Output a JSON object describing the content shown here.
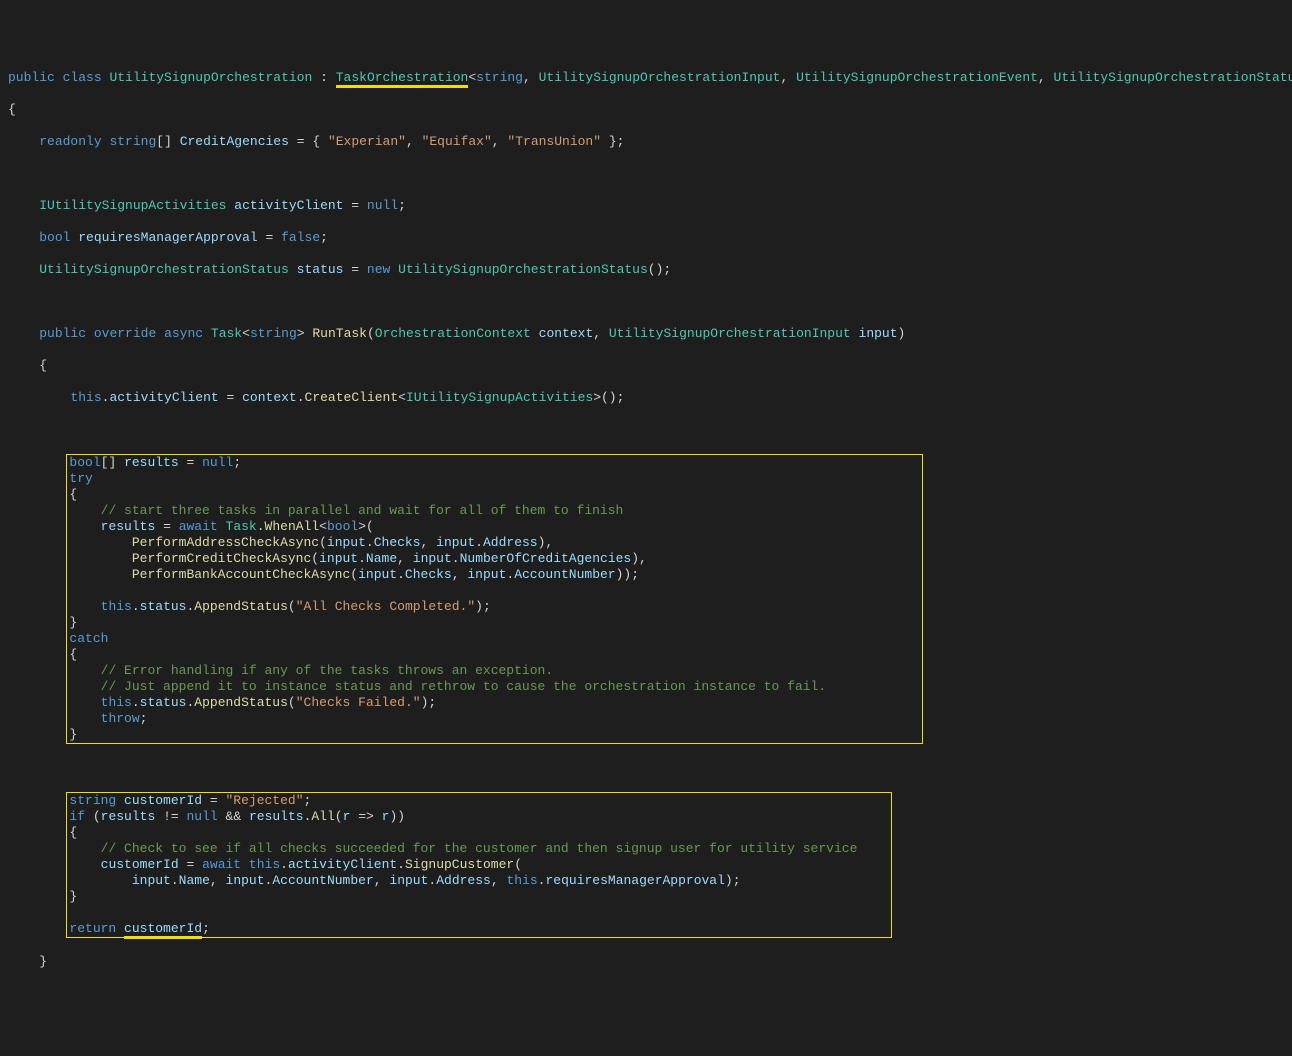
{
  "kw": {
    "public": "public",
    "class": "class",
    "readonly": "readonly",
    "string": "string",
    "bool": "bool",
    "null": "null",
    "false": "false",
    "new": "new",
    "override": "override",
    "async": "async",
    "this": "this",
    "try": "try",
    "catch": "catch",
    "throw": "throw",
    "if": "if",
    "return": "return",
    "await": "await"
  },
  "types": {
    "UtilitySignupOrchestration": "UtilitySignupOrchestration",
    "TaskOrchestration": "TaskOrchestration",
    "UtilitySignupOrchestrationInput": "UtilitySignupOrchestrationInput",
    "UtilitySignupOrchestrationEvent": "UtilitySignupOrchestrationEvent",
    "UtilitySignupOrchestrationStatus": "UtilitySignupOrchestrationStatus",
    "IUtilitySignupActivities": "IUtilitySignupActivities",
    "Task": "Task",
    "OrchestrationContext": "OrchestrationContext"
  },
  "methods": {
    "RunTask": "RunTask",
    "CreateClient": "CreateClient",
    "WhenAll": "WhenAll",
    "PerformAddressCheckAsync": "PerformAddressCheckAsync",
    "PerformCreditCheckAsync": "PerformCreditCheckAsync",
    "PerformBankAccountCheckAsync": "PerformBankAccountCheckAsync",
    "AppendStatus": "AppendStatus",
    "All": "All",
    "SignupCustomer": "SignupCustomer"
  },
  "vars": {
    "CreditAgencies": "CreditAgencies",
    "activityClient": "activityClient",
    "requiresManagerApproval": "requiresManagerApproval",
    "status": "status",
    "context": "context",
    "input": "input",
    "results": "results",
    "Checks": "Checks",
    "Address": "Address",
    "Name": "Name",
    "NumberOfCreditAgencies": "NumberOfCreditAgencies",
    "AccountNumber": "AccountNumber",
    "customerId": "customerId",
    "r": "r"
  },
  "str": {
    "Experian": "\"Experian\"",
    "Equifax": "\"Equifax\"",
    "TransUnion": "\"TransUnion\"",
    "AllChecks": "\"All Checks Completed.\"",
    "ChecksFailed": "\"Checks Failed.\"",
    "Rejected": "\"Rejected\""
  },
  "comments": {
    "c1": "// start three tasks in parallel and wait for all of them to finish",
    "c2": "// Error handling if any of the tasks throws an exception.",
    "c3": "// Just append it to instance status and rethrow to cause the orchestration instance to fail.",
    "c4": "// Check to see if all checks succeeded for the customer and then signup user for utility service"
  }
}
